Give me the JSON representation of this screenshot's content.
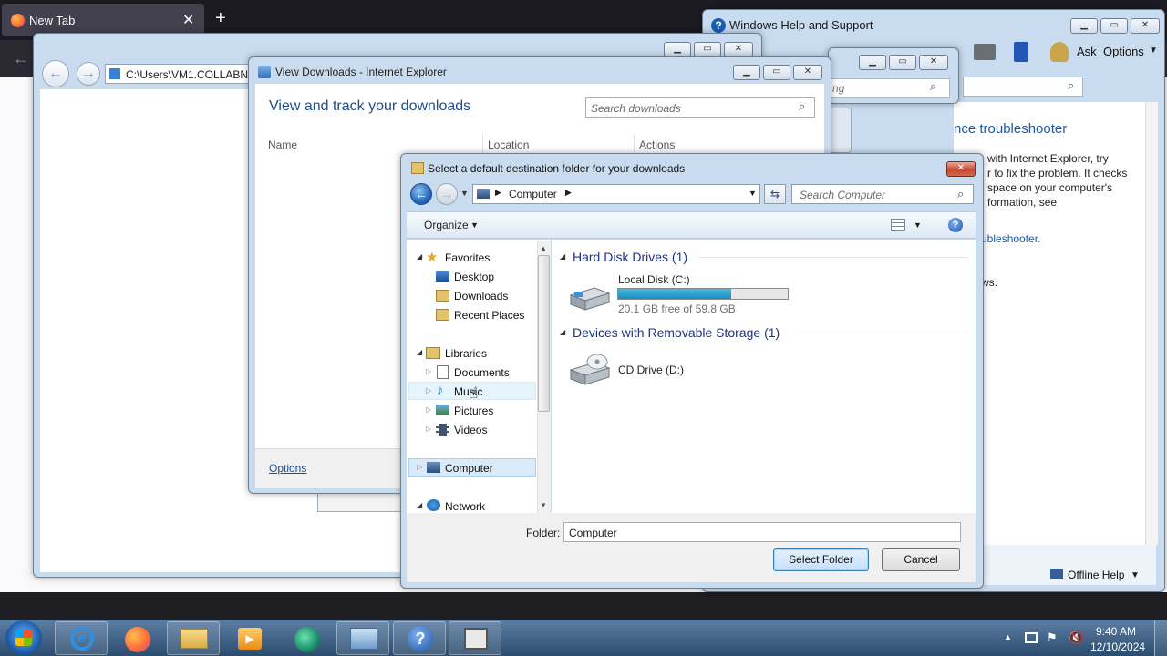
{
  "firefox": {
    "tab_title": "New Tab",
    "new_tab": "+",
    "close": "✕",
    "back": "←"
  },
  "help": {
    "title": "Windows Help and Support",
    "ask": "Ask",
    "options": "Options",
    "heading": "nce troubleshooter",
    "paragraph": "with Internet Explorer, try\nr to fix the problem. It checks\nspace on your computer's\nformation, see",
    "link": "ubleshooter.",
    "ws": "ws.",
    "search_frag": "ng",
    "offline_help": "Offline Help"
  },
  "ie_back": {
    "address": "C:\\Users\\VM1.COLLABNE"
  },
  "view_downloads": {
    "title": "View Downloads - Internet Explorer",
    "heading": "View and track your downloads",
    "search_placeholder": "Search downloads",
    "columns": [
      "Name",
      "Location",
      "Actions"
    ],
    "options_link": "Options"
  },
  "dialog": {
    "title": "Select a default destination folder for your downloads",
    "breadcrumb": "Computer",
    "search_placeholder": "Search Computer",
    "organize": "Organize",
    "nav": {
      "favorites": "Favorites",
      "desktop": "Desktop",
      "downloads": "Downloads",
      "recent": "Recent Places",
      "libraries": "Libraries",
      "documents": "Documents",
      "music": "Music",
      "pictures": "Pictures",
      "videos": "Videos",
      "computer": "Computer",
      "network": "Network"
    },
    "hard_disks_header": "Hard Disk Drives (1)",
    "local_disk": {
      "name": "Local Disk (C:)",
      "free": "20.1 GB free of 59.8 GB",
      "used_fraction": 0.664
    },
    "removable_header": "Devices with Removable Storage (1)",
    "cd_drive": "CD Drive (D:)",
    "folder_label": "Folder:",
    "folder_value": "Computer",
    "select_button": "Select Folder",
    "cancel_button": "Cancel"
  },
  "taskbar": {
    "time": "9:40 AM",
    "date": "12/10/2024"
  }
}
